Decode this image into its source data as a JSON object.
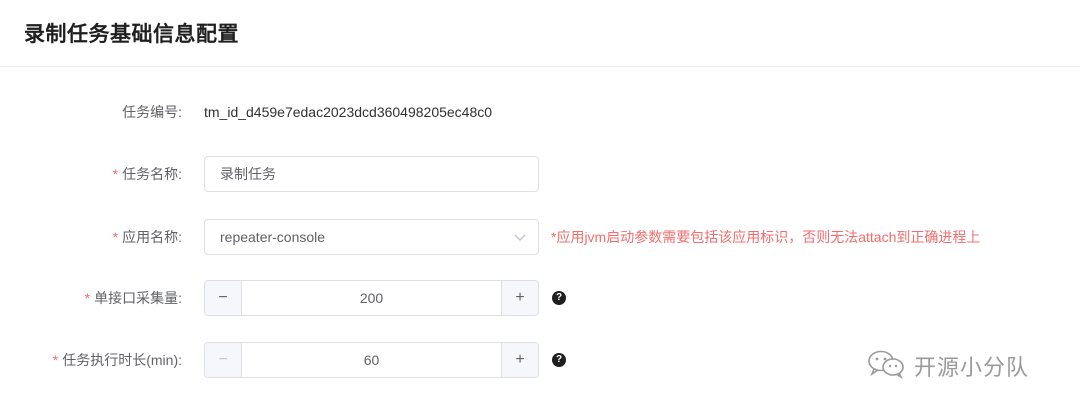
{
  "header": {
    "title": "录制任务基础信息配置"
  },
  "form": {
    "task_id": {
      "label": "任务编号:",
      "value": "tm_id_d459e7edac2023dcd360498205ec48c0"
    },
    "task_name": {
      "required_mark": "*",
      "label": "任务名称:",
      "value": "录制任务"
    },
    "app_name": {
      "required_mark": "*",
      "label": "应用名称:",
      "value": "repeater-console",
      "hint": "*应用jvm启动参数需要包括该应用标识，否则无法attach到正确进程上"
    },
    "sample_count": {
      "required_mark": "*",
      "label": "单接口采集量:",
      "value": "200",
      "minus": "−",
      "plus": "+",
      "help": "?"
    },
    "duration": {
      "required_mark": "*",
      "label": "任务执行时长(min):",
      "value": "60",
      "minus": "−",
      "plus": "+",
      "help": "?"
    }
  },
  "watermark": {
    "text": "开源小分队"
  },
  "colors": {
    "required": "#f56c6c",
    "border": "#dcdfe6",
    "label": "#606266"
  }
}
